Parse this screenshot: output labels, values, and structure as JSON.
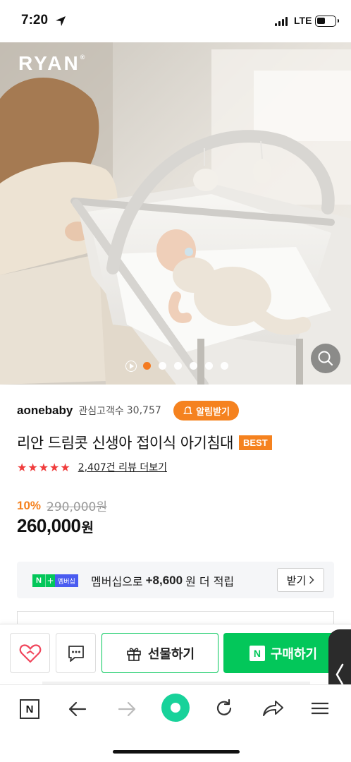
{
  "status": {
    "time": "7:20",
    "network": "LTE"
  },
  "hero": {
    "brand": "RYAN",
    "brand_mark": "®",
    "slide_count": 6,
    "active_slide": 1
  },
  "seller": {
    "name": "aonebaby",
    "follower_label": "관심고객수",
    "follower_count": "30,757",
    "alarm_label": "알림받기"
  },
  "product": {
    "title": "리안 드림콧 신생아 접이식 아기침대",
    "badge": "BEST",
    "stars": "★★★★★",
    "review_text": "2,407건 리뷰 더보기",
    "discount": "10%",
    "original_price": "290,000원",
    "price": "260,000",
    "currency": "원"
  },
  "membership": {
    "n_label": "N",
    "plus_label": "+",
    "tag": "멤버십",
    "text_pre": "멤버십으로",
    "points": "+8,600",
    "text_post": "원 더 적립",
    "button_label": "받기"
  },
  "actions": {
    "gift_label": "선물하기",
    "buy_label": "구매하기",
    "buy_icon": "N"
  },
  "browser": {
    "n_label": "N"
  },
  "colors": {
    "accent_orange": "#f5821f",
    "naver_green": "#03c75a",
    "star_red": "#f03c3c",
    "membership_blue": "#4a5cf0",
    "home_button": "#18d29a"
  }
}
